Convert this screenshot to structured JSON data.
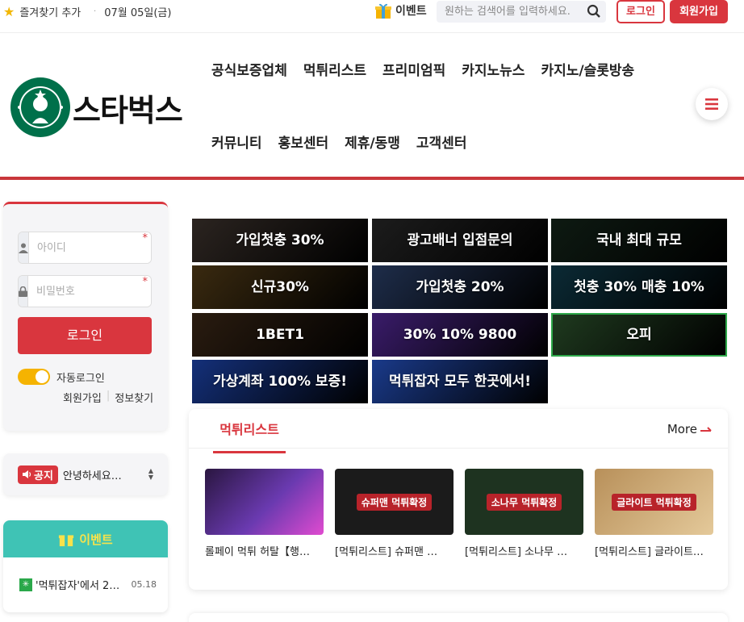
{
  "topbar": {
    "bookmark": "즐겨찾기 추가",
    "date": "07월 05일(금)",
    "event": "이벤트",
    "search_placeholder": "원하는 검색어를 입력하세요.",
    "login": "로그인",
    "join": "회원가입"
  },
  "logo": {
    "text": "스타벅스"
  },
  "nav": {
    "row1": [
      "공식보증업체",
      "먹튀리스트",
      "프리미엄픽",
      "카지노뉴스",
      "카지노/슬롯방송"
    ],
    "row2": [
      "커뮤니티",
      "홍보센터",
      "제휴/동맹",
      "고객센터"
    ]
  },
  "login_box": {
    "id_placeholder": "아이디",
    "pw_placeholder": "비밀번호",
    "login_button": "로그인",
    "auto_login": "자동로그인",
    "join_link": "회원가입",
    "find_link": "정보찾기"
  },
  "notice": {
    "tag": "공지",
    "text": "안녕하세요…"
  },
  "event_box": {
    "title": "이벤트",
    "item": "'먹튀잡자'에서 2…",
    "date": "05.18"
  },
  "banners": [
    {
      "text": "가입첫충 30%",
      "color": "#2b2420"
    },
    {
      "text": "광고배너 입점문의",
      "color": "#1c1c1c"
    },
    {
      "text": "국내 최대 규모",
      "color": "#0e1a12"
    },
    {
      "text": "신규30%",
      "color": "#3a2a10"
    },
    {
      "text": "가입첫충 20%",
      "color": "#1e2d4a"
    },
    {
      "text": "첫충 30% 매충 10%",
      "color": "#0b2a35"
    },
    {
      "text": "1BET1",
      "color": "#2a1c10"
    },
    {
      "text": "30% 10% 9800",
      "color": "#3a1c6a"
    },
    {
      "text": "오피",
      "color": "#1f3a1f"
    },
    {
      "text": "가상계좌 100% 보증!",
      "color": "#14307a"
    },
    {
      "text": "먹튀잡자 모두 한곳에서!",
      "color": "#1a3a8a"
    }
  ],
  "scam_list": {
    "tab": "먹튀리스트",
    "more": "More",
    "items": [
      {
        "caption": "롤페이 먹튀 허탈【행…",
        "badge": "",
        "color": "#4a2a7a"
      },
      {
        "caption": "[먹튀리스트] 슈퍼맨 …",
        "badge": "슈퍼맨 먹튀확정",
        "color": "#222222"
      },
      {
        "caption": "[먹튀리스트] 소나무 …",
        "badge": "소나무 먹튀확정",
        "color": "#1e3320"
      },
      {
        "caption": "[먹튀리스트] 글라이트…",
        "badge": "글라이트 먹튀확정",
        "color": "#c9a46a"
      }
    ]
  },
  "colors": {
    "accent": "#d9363e",
    "event_header": "#3fc3b5"
  }
}
